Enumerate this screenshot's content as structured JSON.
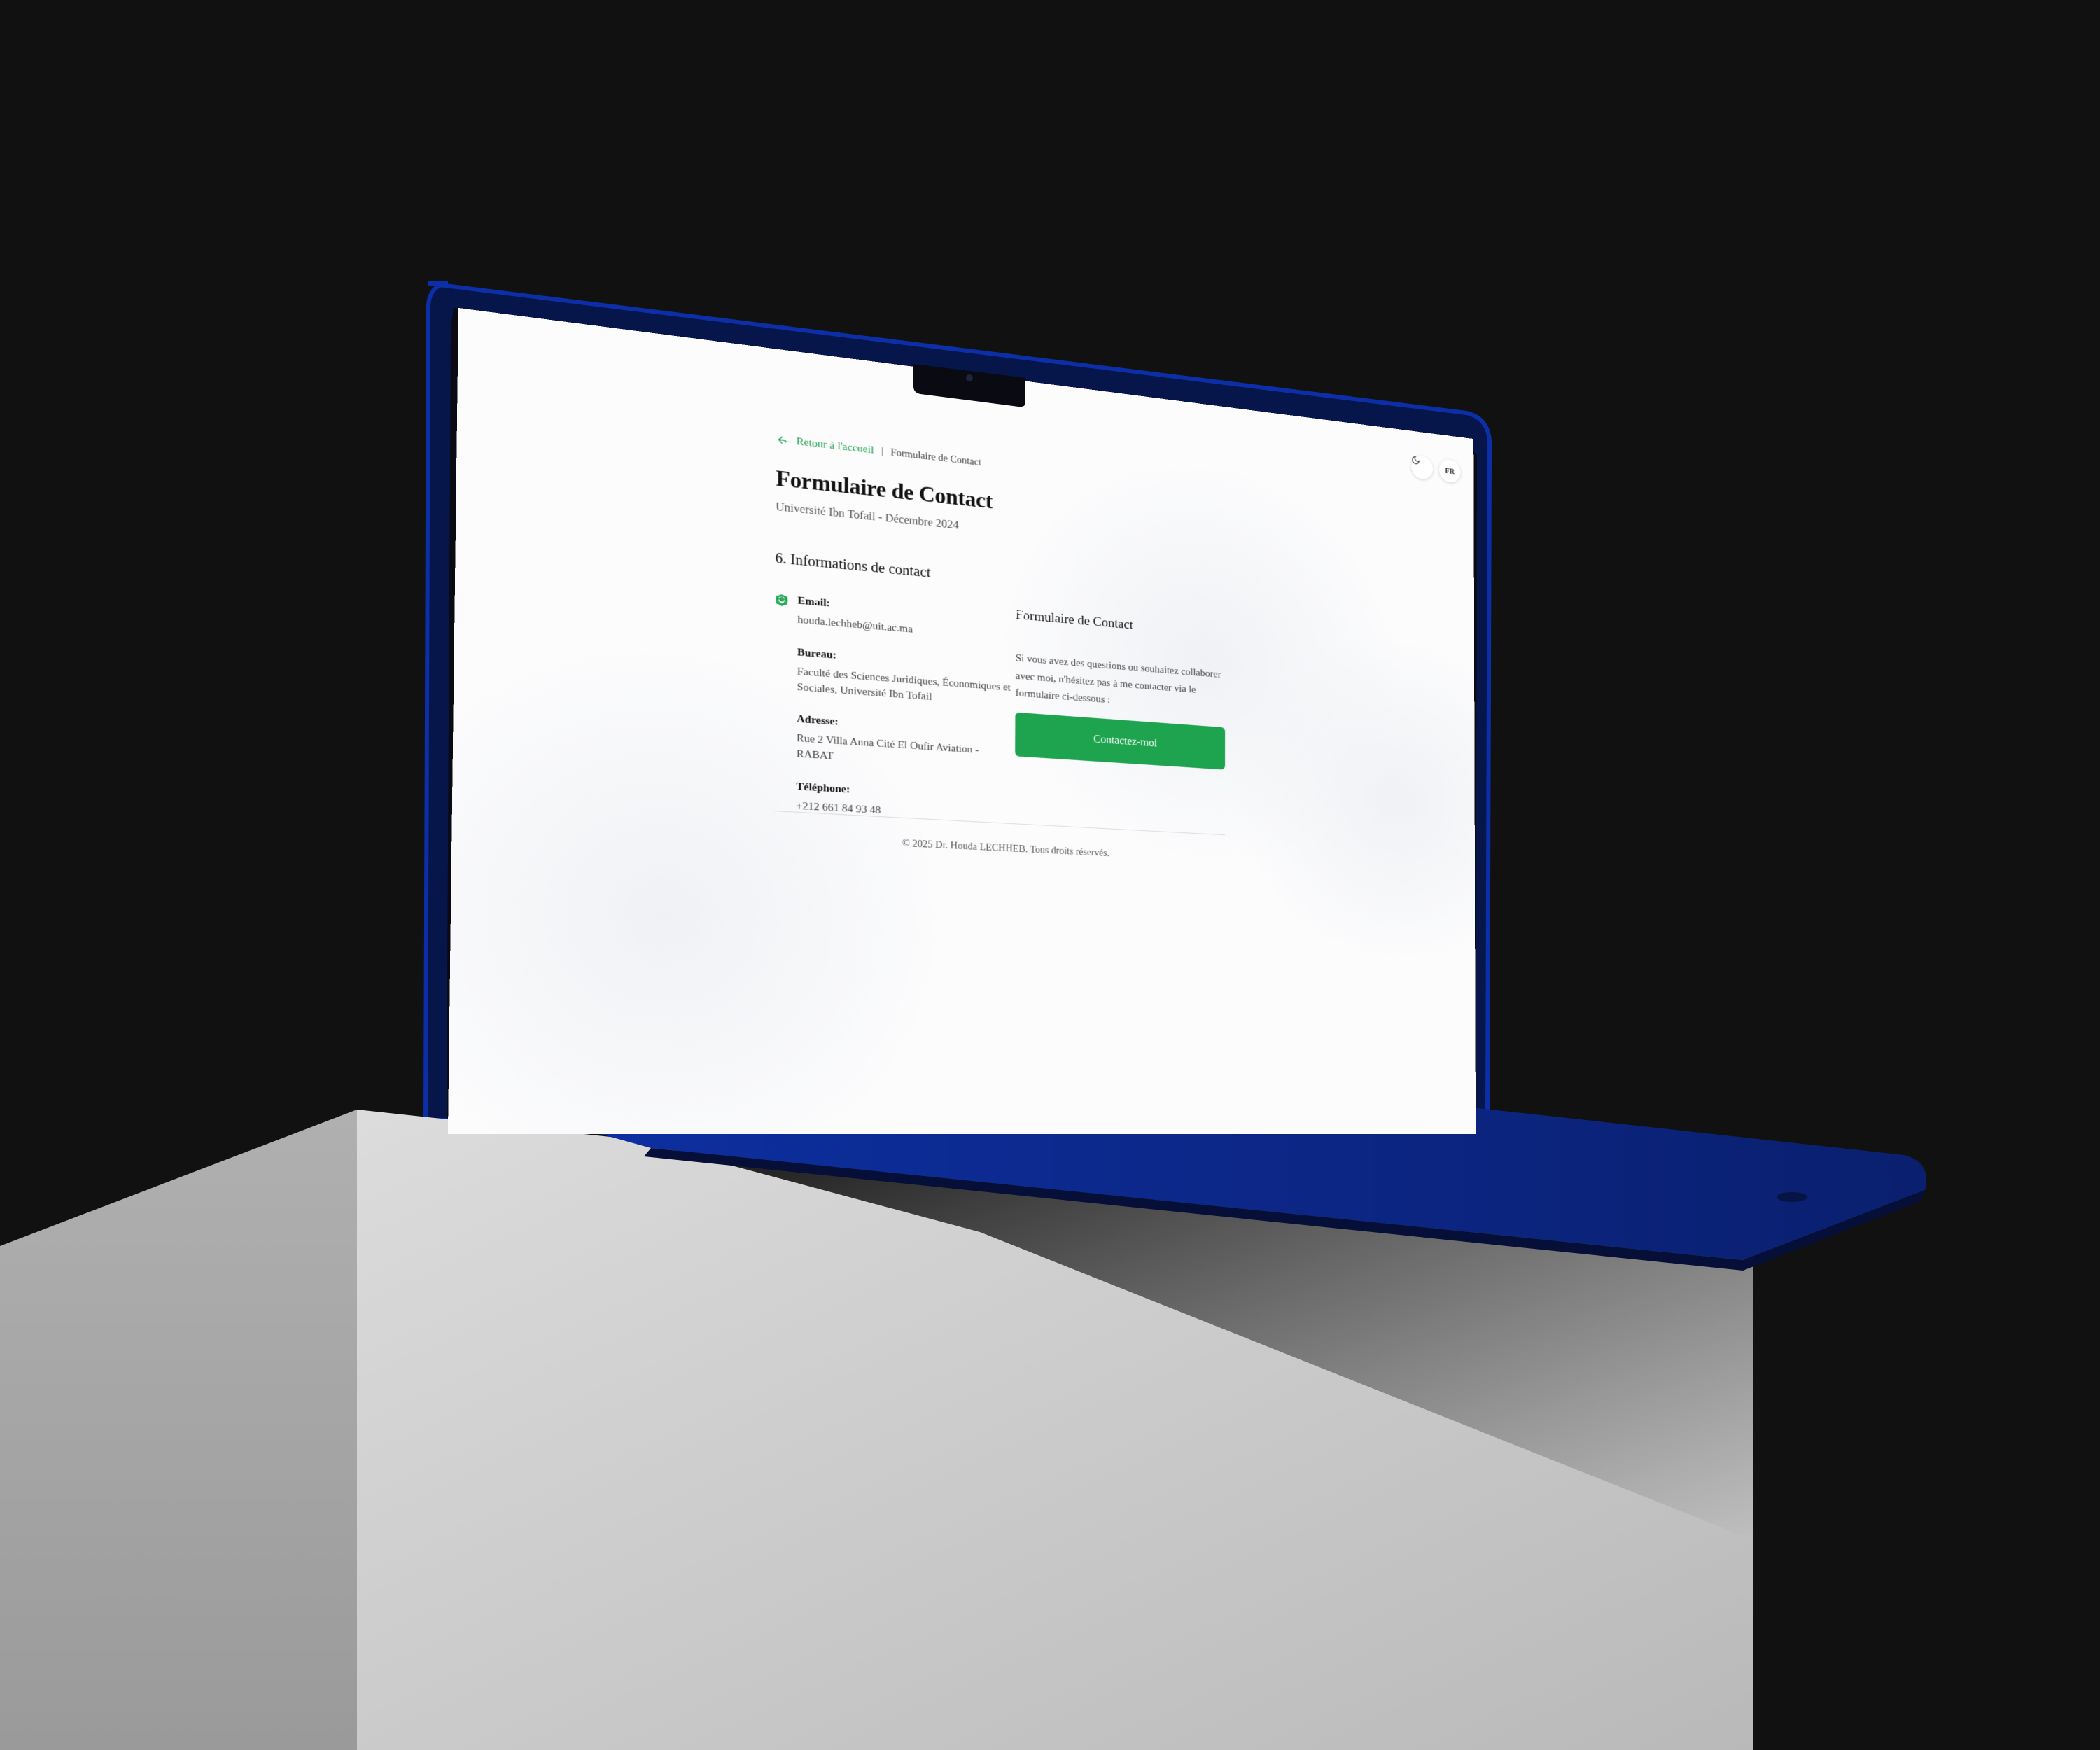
{
  "breadcrumb": {
    "back_label": "← Retour à l'accueil",
    "separator": "|",
    "current": "Formulaire de Contact"
  },
  "header": {
    "title": "Formulaire de Contact",
    "subtitle": "Université Ibn Tofail - Décembre 2024"
  },
  "top_controls": {
    "theme_icon": "moon-icon",
    "language": "FR"
  },
  "contact_info": {
    "section_title": "6. Informations de contact",
    "items": [
      {
        "icon": "mail-icon",
        "label": "Email:",
        "value": "houda.lechheb@uit.ac.ma"
      },
      {
        "icon": "map-pin-icon",
        "label": "Bureau:",
        "value": "Faculté des Sciences Juridiques, Économiques et Sociales, Université Ibn Tofail"
      },
      {
        "icon": "map-pin-icon",
        "label": "Adresse:",
        "value": "Rue 2 Villa Anna Cité El Oufir Aviation - RABAT"
      },
      {
        "icon": "clock-icon",
        "label": "Téléphone:",
        "value": "+212 661 84 93 48"
      }
    ]
  },
  "contact_form": {
    "title": "Formulaire de Contact",
    "text": "Si vous avez des questions ou souhaitez collaborer avec moi, n'hésitez pas à me contacter via le formulaire ci-dessous :",
    "button_label": "Contactez-moi",
    "button_icon": "send-icon"
  },
  "footer": {
    "text": "© 2025 Dr. Houda LECHHEB. Tous droits réservés."
  },
  "colors": {
    "accent": "#1ea44f",
    "laptop_body": "#0b2a8a",
    "background": "#111111",
    "pedestal": "#c9c9c9"
  }
}
